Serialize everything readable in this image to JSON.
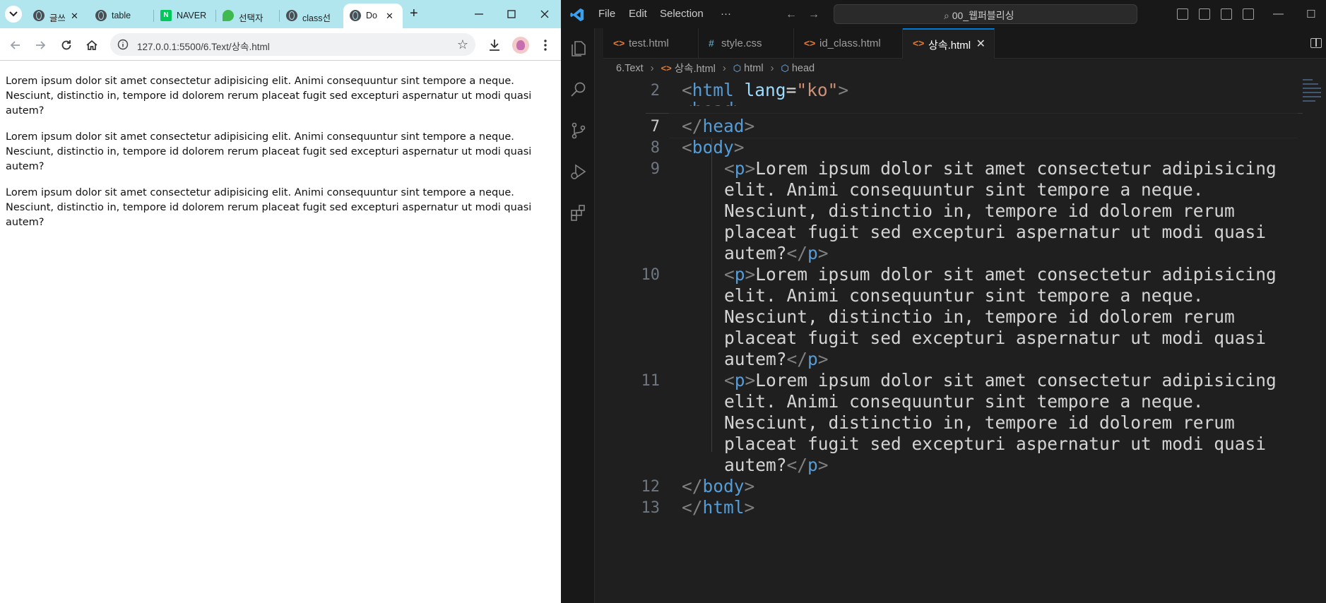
{
  "browser": {
    "tabs": [
      {
        "label": "글쓰",
        "favicon": "globe-icon"
      },
      {
        "label": "table",
        "favicon": "globe-icon"
      },
      {
        "label": "NAVER",
        "favicon": "naver-icon"
      },
      {
        "label": "선택자",
        "favicon": "leaf-icon"
      },
      {
        "label": "class선",
        "favicon": "globe-icon"
      },
      {
        "label": "Do",
        "favicon": "globe-icon",
        "active": true
      }
    ],
    "url": "127.0.0.1:5500/6.Text/상속.html",
    "paragraphs": [
      "Lorem ipsum dolor sit amet consectetur adipisicing elit. Animi consequuntur sint tempore a neque. Nesciunt, distinctio in, tempore id dolorem rerum placeat fugit sed excepturi aspernatur ut modi quasi autem?",
      "Lorem ipsum dolor sit amet consectetur adipisicing elit. Animi consequuntur sint tempore a neque. Nesciunt, distinctio in, tempore id dolorem rerum placeat fugit sed excepturi aspernatur ut modi quasi autem?",
      "Lorem ipsum dolor sit amet consectetur adipisicing elit. Animi consequuntur sint tempore a neque. Nesciunt, distinctio in, tempore id dolorem rerum placeat fugit sed excepturi aspernatur ut modi quasi autem?"
    ]
  },
  "vscode": {
    "menu": [
      "File",
      "Edit",
      "Selection",
      "···"
    ],
    "search": "00_웹퍼블리싱",
    "tabs": [
      {
        "label": "test.html",
        "icon": "<>"
      },
      {
        "label": "style.css",
        "icon": "#"
      },
      {
        "label": "id_class.html",
        "icon": "<>"
      },
      {
        "label": "상속.html",
        "icon": "<>",
        "active": true,
        "close": "✕"
      }
    ],
    "breadcrumb": [
      "6.Text",
      "상속.html",
      "html",
      "head"
    ],
    "sticky_line": {
      "num": "2",
      "code": "<html lang=\"ko\">"
    },
    "lines": [
      {
        "num": "7",
        "text": "</head>"
      },
      {
        "num": "8",
        "text": "<body>"
      },
      {
        "num": "9",
        "wrap": [
          "<p>Lorem ipsum dolor sit amet consectetur adipisicing",
          "elit. Animi consequuntur sint tempore a neque.",
          "Nesciunt, distinctio in, tempore id dolorem rerum",
          "placeat fugit sed excepturi aspernatur ut modi quasi",
          "autem?</p>"
        ]
      },
      {
        "num": "10",
        "wrap": [
          "<p>Lorem ipsum dolor sit amet consectetur adipisicing",
          "elit. Animi consequuntur sint tempore a neque.",
          "Nesciunt, distinctio in, tempore id dolorem rerum",
          "placeat fugit sed excepturi aspernatur ut modi quasi",
          "autem?</p>"
        ]
      },
      {
        "num": "11",
        "wrap": [
          "<p>Lorem ipsum dolor sit amet consectetur adipisicing",
          "elit. Animi consequuntur sint tempore a neque.",
          "Nesciunt, distinctio in, tempore id dolorem rerum",
          "placeat fugit sed excepturi aspernatur ut modi quasi",
          "autem?</p>"
        ]
      },
      {
        "num": "12",
        "text": "</body>"
      },
      {
        "num": "13",
        "text": "</html>"
      }
    ],
    "colors": {
      "accent": "#0078d4",
      "tag": "#569cd6",
      "attr": "#9cdcfe",
      "string": "#ce9178"
    }
  }
}
